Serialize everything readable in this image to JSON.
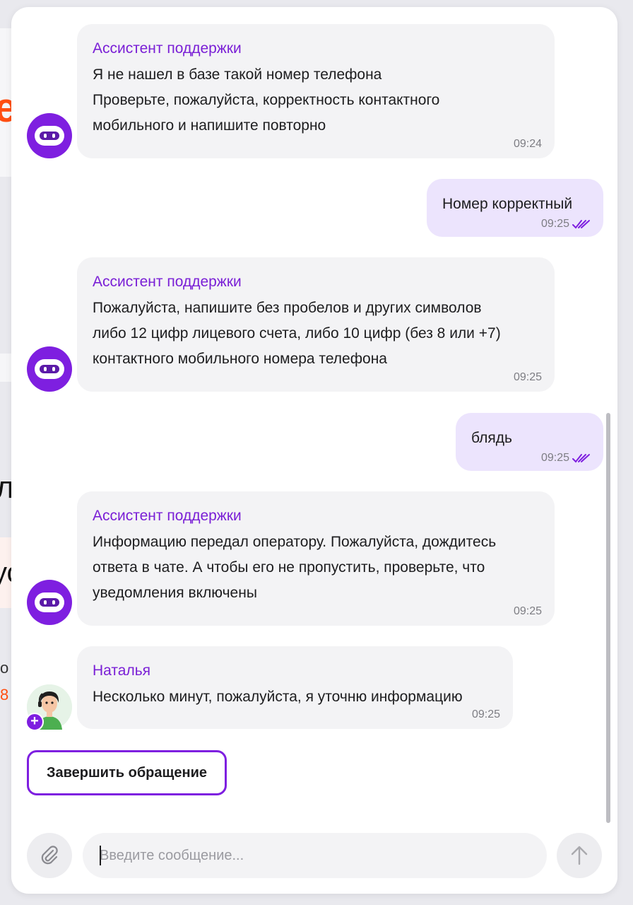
{
  "chat": {
    "messages": [
      {
        "type": "incoming",
        "sender": "Ассистент поддержки",
        "lines": [
          "Я не нашел в базе такой номер телефона",
          "Проверьте, пожалуйста, корректность контактного",
          "мобильного и напишите повторно"
        ],
        "time": "09:24",
        "avatar": "robot-icon"
      },
      {
        "type": "outgoing",
        "text": "Номер корректный",
        "time": "09:25",
        "status": "read"
      },
      {
        "type": "incoming",
        "sender": "Ассистент поддержки",
        "lines": [
          "Пожалуйста, напишите без пробелов и других символов",
          "либо 12 цифр лицевого счета, либо 10 цифр (без 8 или +7)",
          "контактного мобильного номера телефона"
        ],
        "time": "09:25",
        "avatar": "robot-icon"
      },
      {
        "type": "outgoing",
        "text": "блядь",
        "time": "09:25",
        "status": "read"
      },
      {
        "type": "incoming",
        "sender": "Ассистент поддержки",
        "lines": [
          "Информацию передал оператору. Пожалуйста, дождитесь",
          "ответа в чате. А чтобы его не пропустить, проверьте, что",
          "уведомления включены"
        ],
        "time": "09:25",
        "avatar": "robot-icon"
      },
      {
        "type": "incoming",
        "sender": "Наталья",
        "lines": [
          "Несколько минут, пожалуйста, я уточню информацию"
        ],
        "time": "09:25",
        "avatar": "operator-avatar"
      }
    ],
    "end_button_label": "Завершить обращение"
  },
  "composer": {
    "placeholder": "Введите сообщение...",
    "value": ""
  },
  "background_fragments": [
    "el",
    "л",
    "ус",
    "о",
    "8"
  ],
  "colors": {
    "accent": "#7e1fe0",
    "outgoing_bubble": "#ece4fd",
    "incoming_bubble": "#f3f3f5",
    "brand_orange": "#ff4f12"
  }
}
